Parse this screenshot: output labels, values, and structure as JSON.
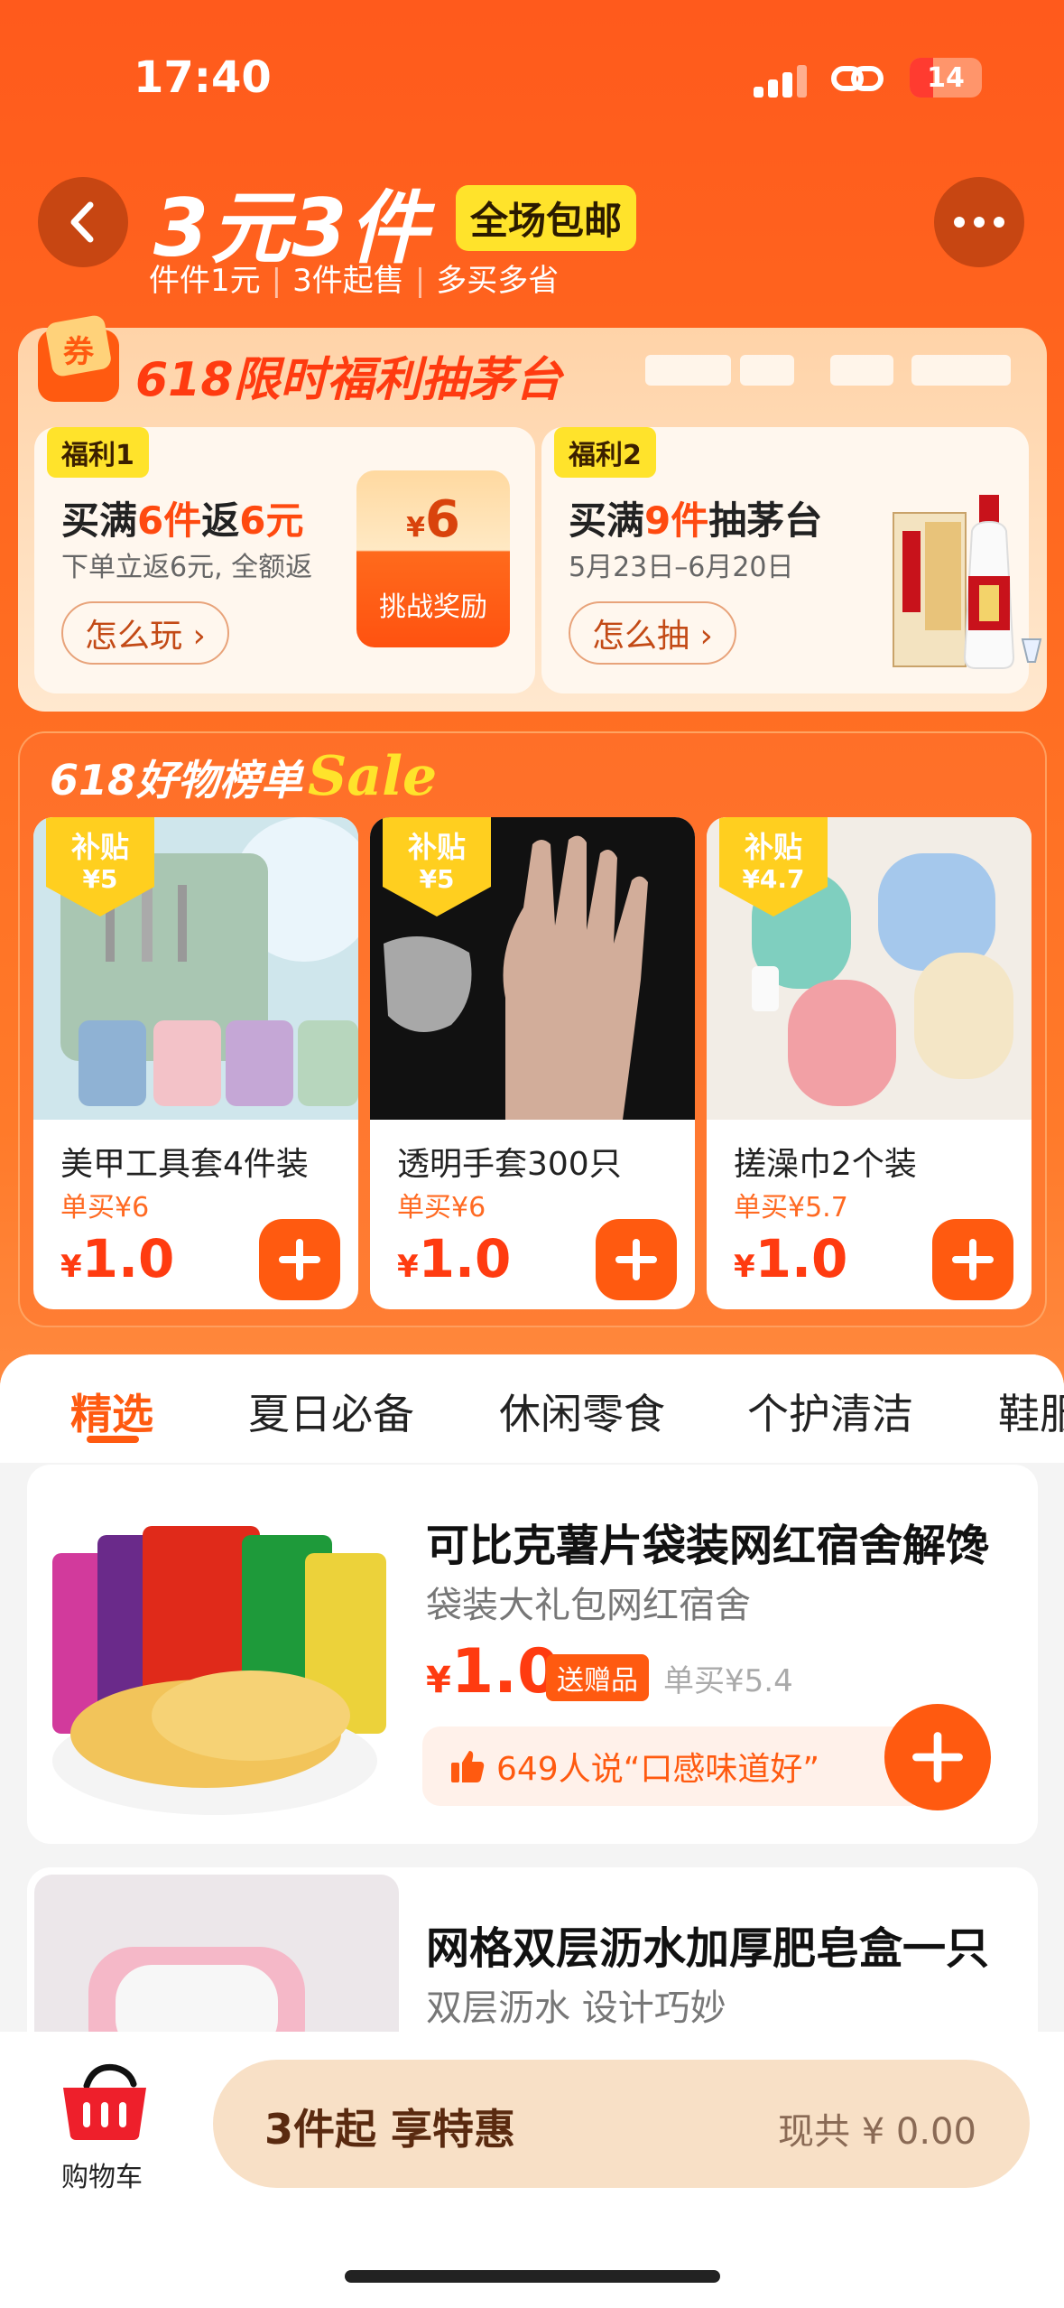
{
  "status_bar": {
    "time": "17:40",
    "battery": "14"
  },
  "header": {
    "title": "3元3件",
    "badge": "全场包邮",
    "subtitle_parts": [
      "件件1元",
      "3件起售",
      "多买多省"
    ]
  },
  "lottery": {
    "title": "618限时福利抽茅台",
    "welfare1": {
      "tag": "福利1",
      "title_pre": "买满",
      "title_hl1": "6件",
      "title_mid": "返",
      "title_hl2": "6元",
      "desc": "下单立返6元, 全额返",
      "button": "怎么玩 ›",
      "packet_currency": "¥",
      "packet_value": "6",
      "packet_label": "挑战奖励"
    },
    "welfare2": {
      "tag": "福利2",
      "title_pre": "买满",
      "title_hl": "9件",
      "title_post": "抽茅台",
      "desc": "5月23日–6月20日",
      "button": "怎么抽 ›"
    }
  },
  "best_sellers": {
    "title": "618好物榜单",
    "sale_word": "Sale",
    "products": [
      {
        "subsidy_label": "补贴",
        "subsidy_value": "¥5",
        "name": "美甲工具套4件装",
        "single": "单买¥6",
        "currency": "¥",
        "price": "1.0"
      },
      {
        "subsidy_label": "补贴",
        "subsidy_value": "¥5",
        "name": "透明手套300只",
        "single": "单买¥6",
        "currency": "¥",
        "price": "1.0"
      },
      {
        "subsidy_label": "补贴",
        "subsidy_value": "¥4.7",
        "name": "搓澡巾2个装",
        "single": "单买¥5.7",
        "currency": "¥",
        "price": "1.0"
      }
    ]
  },
  "tabs": [
    "精选",
    "夏日必备",
    "休闲零食",
    "个护清洁",
    "鞋服"
  ],
  "items": [
    {
      "name": "可比克薯片袋装网红宿舍解馋",
      "subtitle": "袋装大礼包网红宿舍",
      "currency": "¥",
      "price": "1.0",
      "gift": "送赠品",
      "single": "单买¥5.4",
      "review": "649人说“口感味道好”"
    },
    {
      "name": "网格双层沥水加厚肥皂盒一只",
      "subtitle": "双层沥水 设计巧妙"
    }
  ],
  "bottom_bar": {
    "cart_label": "购物车",
    "cta_label": "3件起 享特惠",
    "cta_total": "现共 ¥ 0.00"
  },
  "colors": {
    "brand_orange": "#ff5a10",
    "price_red": "#ff3b10",
    "badge_yellow": "#ffe32b"
  }
}
